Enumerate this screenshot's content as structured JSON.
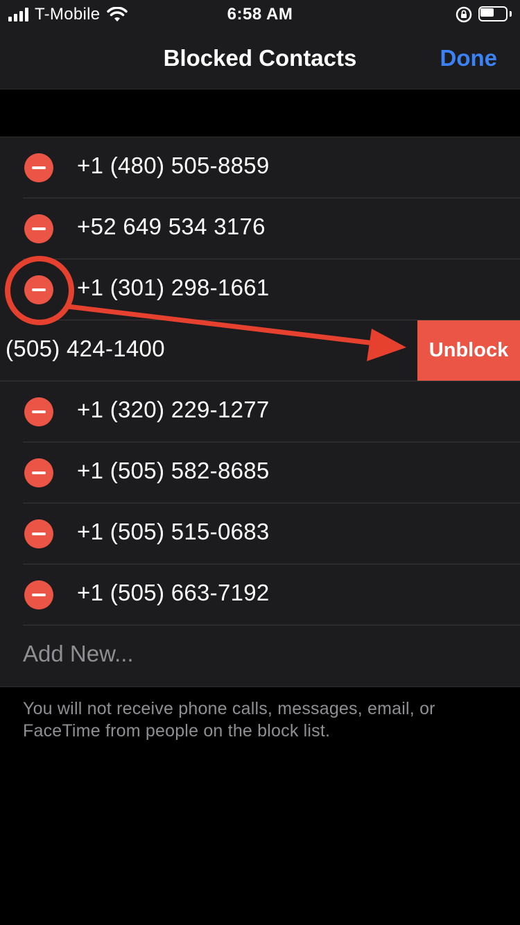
{
  "status_bar": {
    "carrier": "T-Mobile",
    "time": "6:58 AM",
    "icons": [
      "signal-icon",
      "wifi-icon",
      "rotation-lock-icon",
      "battery-icon"
    ]
  },
  "nav": {
    "title": "Blocked Contacts",
    "done_label": "Done"
  },
  "contacts": [
    "+1 (480) 505-8859",
    "+52 649 534 3176",
    "+1 (301) 298-1661",
    "(505) 424-1400",
    "+1 (320) 229-1277",
    "+1 (505) 582-8685",
    "+1 (505) 515-0683",
    "+1 (505) 663-7192"
  ],
  "unblock_label": "Unblock",
  "add_new_label": "Add New...",
  "footer_note": "You will not receive phone calls, messages, email, or FaceTime from people on the block list.",
  "colors": {
    "accent": "#3b82f6",
    "destructive": "#eb5545",
    "annotation": "#e5412e"
  }
}
